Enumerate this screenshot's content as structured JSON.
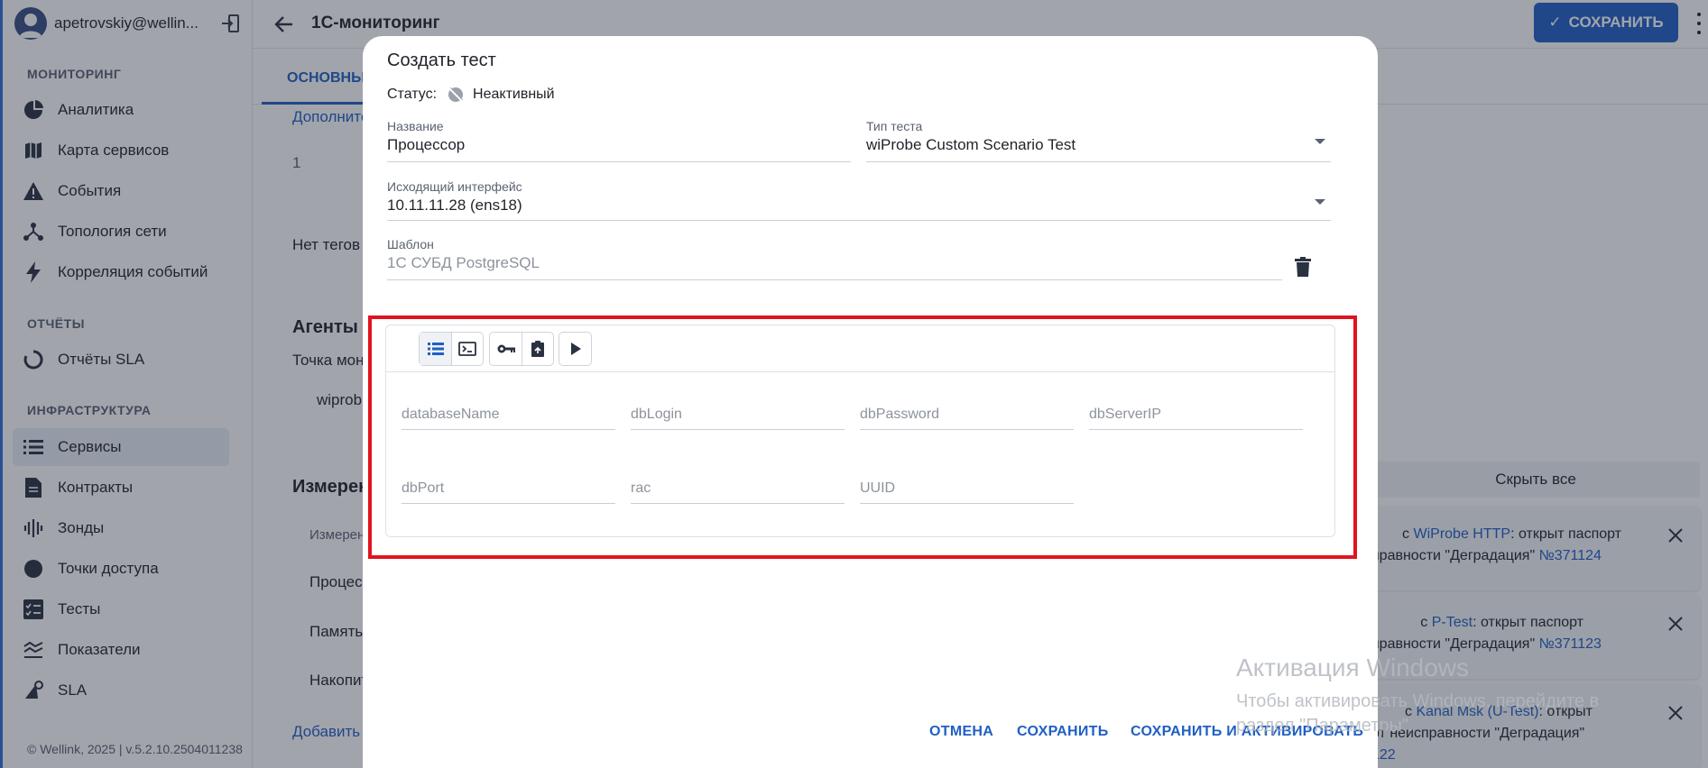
{
  "user": {
    "name": "apetrovskiy@wellin..."
  },
  "sidebar": {
    "sections": [
      {
        "title": "МОНИТОРИНГ",
        "items": [
          "Аналитика",
          "Карта сервисов",
          "События",
          "Топология сети",
          "Корреляция событий"
        ]
      },
      {
        "title": "ОТЧЁТЫ",
        "items": [
          "Отчёты SLA"
        ]
      },
      {
        "title": "ИНФРАСТРУКТУРА",
        "items": [
          "Сервисы",
          "Контракты",
          "Зонды",
          "Точки доступа",
          "Тесты",
          "Показатели",
          "SLA"
        ]
      }
    ],
    "active_item": "Сервисы",
    "footer": "© Wellink, 2025 | v.5.2.10.2504011238"
  },
  "header": {
    "title": "1С-мониторинг",
    "save_label": "СОХРАНИТЬ"
  },
  "background": {
    "tab_main": "ОСНОВНЫ",
    "additional_link": "Дополните",
    "number": "1",
    "no_tags": "Нет тегов",
    "agents_heading": "Агенты",
    "point_text": "Точка мон",
    "agent_name": "wiprob",
    "measurements_heading": "Измерен",
    "measurements_col": "Измерен",
    "rows": [
      "Процес",
      "Память",
      "Накопит"
    ],
    "add_link": "Добавить"
  },
  "notifications": {
    "hide_all": "Скрыть все",
    "items": [
      {
        "prefix": "с ",
        "link": "WiProbe HTTP",
        "middle": ": открыт паспорт",
        "line2": "правности \"Деградация\" ",
        "ticket": "№371124"
      },
      {
        "prefix": "с ",
        "link": "P-Test",
        "middle": ": открыт паспорт",
        "line2": "правности \"Деградация\" ",
        "ticket": "№371123"
      },
      {
        "prefix": "с ",
        "link": "Kanal Msk (U-Test)",
        "middle": ": открыт",
        "line2": "рт неисправности \"Деградация\"",
        "ticket": "122"
      }
    ]
  },
  "dialog": {
    "title": "Создать тест",
    "status_label": "Статус:",
    "status_value": "Неактивный",
    "name_label": "Название",
    "name_value": "Процессор",
    "type_label": "Тип теста",
    "type_value": "wiProbe Custom Scenario Test",
    "interface_label": "Исходящий интерфейс",
    "interface_value": "10.11.11.28 (ens18)",
    "template_label": "Шаблон",
    "template_value": "1С СУБД PostgreSQL",
    "params": [
      "databaseName",
      "dbLogin",
      "dbPassword",
      "dbServerIP",
      "dbPort",
      "rac",
      "UUID"
    ],
    "actions": {
      "cancel": "ОТМЕНА",
      "save": "СОХРАНИТЬ",
      "save_activate": "СОХРАНИТЬ И АКТИВИРОВАТЬ"
    }
  },
  "watermark": {
    "title": "Активация Windows",
    "subtitle": "Чтобы активировать Windows, перейдите в раздел \"Параметры\"."
  },
  "icons": {
    "sidebar": [
      "pie-chart-icon",
      "map-icon",
      "warning-icon",
      "topology-icon",
      "bolt-icon",
      "sla-report-icon",
      "list-icon",
      "document-icon",
      "waveform-icon",
      "circle-icon",
      "checklist-icon",
      "metrics-icon",
      "sla-icon"
    ]
  },
  "colors": {
    "accent": "#1f5fc4",
    "highlight_frame": "#e0141e"
  }
}
